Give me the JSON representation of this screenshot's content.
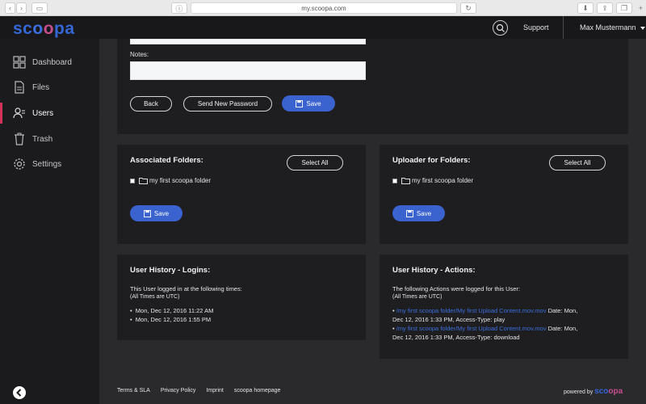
{
  "browser": {
    "url": "my.scoopa.com"
  },
  "header": {
    "logo": {
      "s": "sc",
      "o1": "o",
      "o2": "o",
      "rest": "pa"
    },
    "support": "Support",
    "user": "Max Mustermann"
  },
  "sidebar": {
    "items": [
      {
        "label": "Dashboard",
        "icon": "dashboard-icon"
      },
      {
        "label": "Files",
        "icon": "file-icon"
      },
      {
        "label": "Users",
        "icon": "users-icon"
      },
      {
        "label": "Trash",
        "icon": "trash-icon"
      },
      {
        "label": "Settings",
        "icon": "gear-icon"
      }
    ],
    "active": "Users"
  },
  "form": {
    "notes_label": "Notes:",
    "notes_value": "",
    "back": "Back",
    "send_password": "Send New Password",
    "save": "Save"
  },
  "assoc": {
    "title": "Associated Folders:",
    "select_all": "Select All",
    "folder": "my first scoopa folder",
    "save": "Save"
  },
  "uploader": {
    "title": "Uploader for Folders:",
    "select_all": "Select All",
    "folder": "my first scoopa folder",
    "save": "Save"
  },
  "logins": {
    "title": "User History - Logins:",
    "intro": "This User logged in at the following times:",
    "tz": "(All Times are UTC)",
    "entries": [
      "Mon, Dec 12, 2016 11:22 AM",
      "Mon, Dec 12, 2016 1:55 PM"
    ]
  },
  "actions": {
    "title": "User History - Actions:",
    "intro": "The following Actions were logged for this User:",
    "tz": "(All Times are UTC)",
    "entries": [
      {
        "path": "/my first scoopa folder/My first Upload Content.mov.mov",
        "date_label": "Date:",
        "line1_end": "Mon,",
        "line2": "Dec 12, 2016 1:33 PM, Access-Type: play"
      },
      {
        "path": "/my first scoopa folder/My first Upload Content.mov.mov",
        "date_label": "Date:",
        "line1_end": "Mon,",
        "line2": "Dec 12, 2016 1:33 PM, Access-Type: download"
      }
    ]
  },
  "footer": {
    "links": [
      "Terms & SLA",
      "Privacy Policy",
      "Imprint",
      "scoopa homepage"
    ],
    "powered": "powered by",
    "brand_a": "sco",
    "brand_b": "opa"
  },
  "colors": {
    "accent": "#3a63cf",
    "active_bar": "#d6335a",
    "bg": "#2a2a2d",
    "card": "#1e1e21"
  }
}
